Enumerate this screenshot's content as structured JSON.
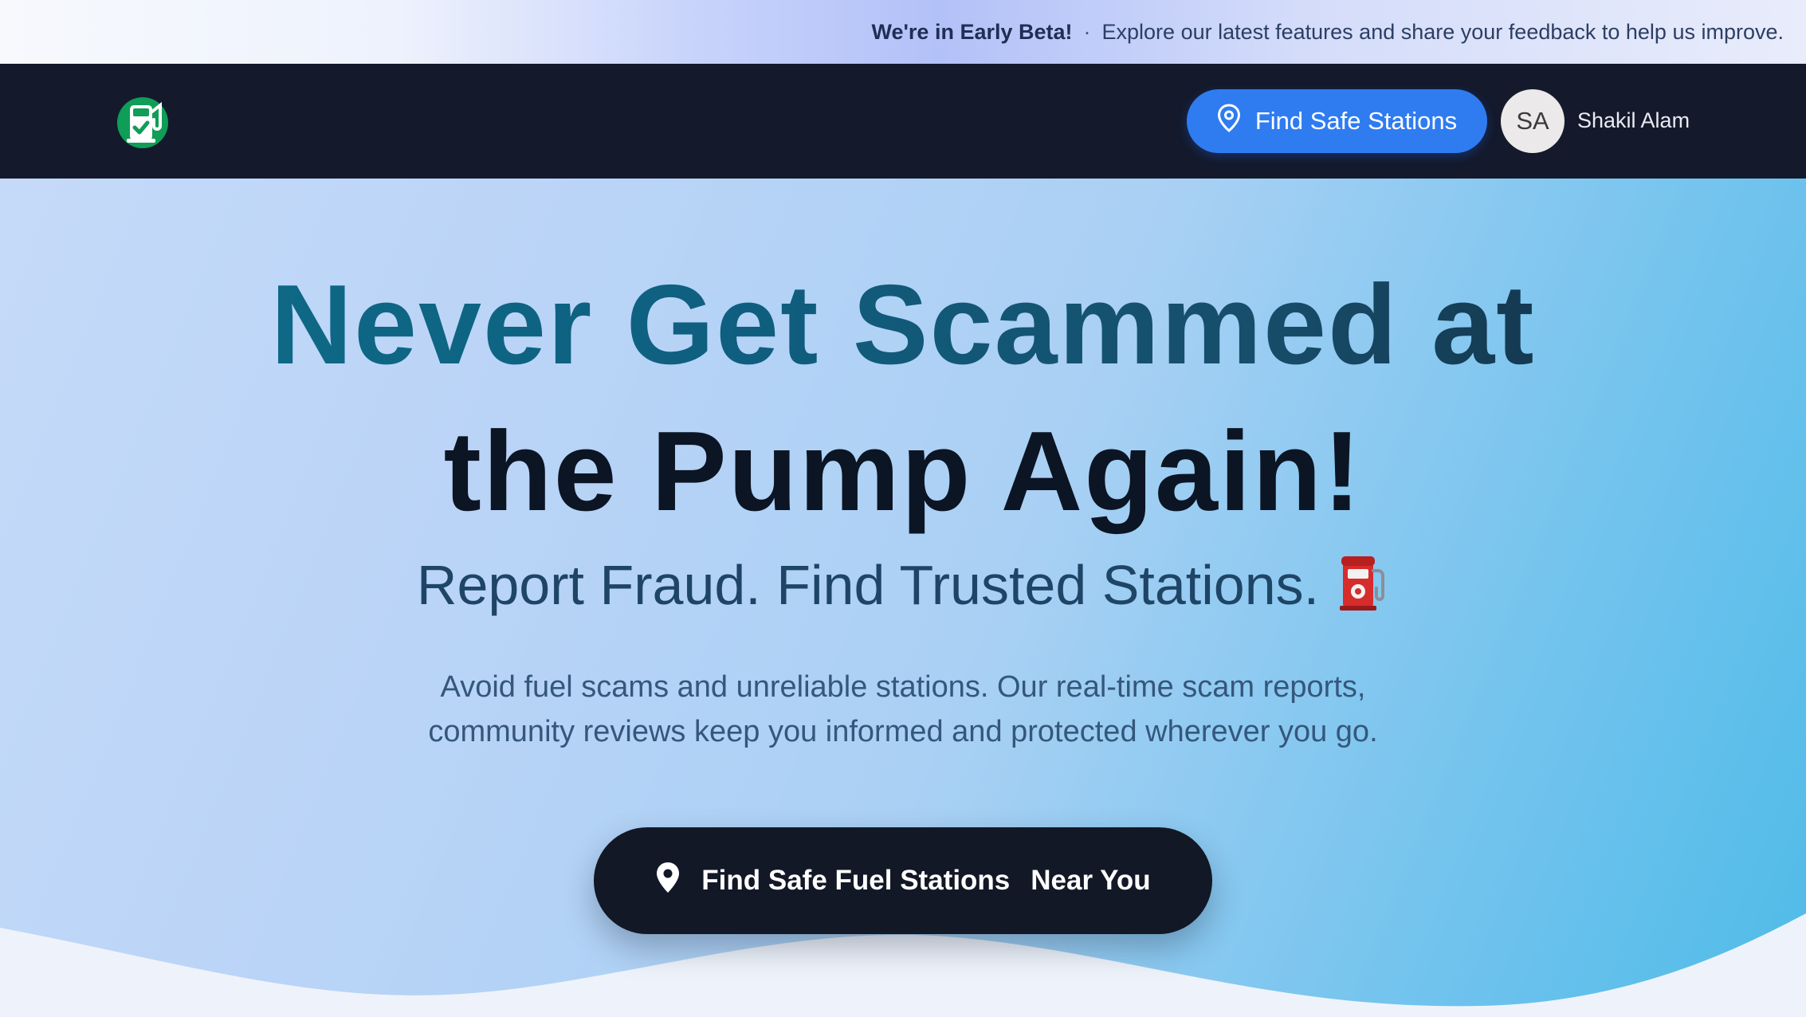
{
  "banner": {
    "title": "We're in Early Beta!",
    "separator": "·",
    "message": "Explore our latest features and share your feedback to help us improve."
  },
  "nav": {
    "logo_icon": "fuel-pump-check-icon",
    "find_button_label": "Find Safe Stations",
    "find_button_icon": "map-pin-outline-icon",
    "avatar_initials": "SA",
    "user_name": "Shakil Alam"
  },
  "hero": {
    "headline_line1": "Never Get Scammed at",
    "headline_line2": "the Pump Again!",
    "subheadline": "Report Fraud. Find Trusted Stations.",
    "subheadline_icon": "fuel-pump-emoji",
    "description_line1": "Avoid fuel scams and unreliable stations. Our real-time scam reports,",
    "description_line2": "community reviews keep you informed and protected wherever you go.",
    "cta_label": "Find Safe Fuel Stations",
    "cta_suffix": "Near You",
    "cta_icon": "map-pin-filled-icon"
  },
  "colors": {
    "nav_background": "#141a2c",
    "primary_button": "#2f7cf1",
    "cta_background": "#121826",
    "headline_teal": "#0f6a86",
    "headline_dark": "#0c1524"
  }
}
